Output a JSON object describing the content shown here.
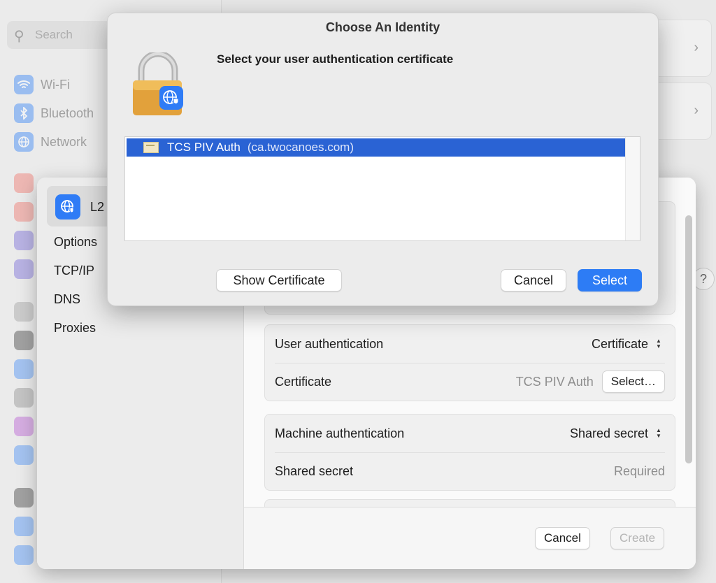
{
  "background": {
    "search_placeholder": "Search",
    "sidebar_items": [
      {
        "label": "Wi-Fi",
        "icon": "wifi-icon",
        "color": "#3a86f7"
      },
      {
        "label": "Bluetooth",
        "icon": "bluetooth-icon",
        "color": "#3a86f7"
      },
      {
        "label": "Network",
        "icon": "globe-icon",
        "color": "#3a86f7"
      }
    ],
    "help_label": "?"
  },
  "sheet": {
    "vpn_name": "L2",
    "nav": [
      "Options",
      "TCP/IP",
      "DNS",
      "Proxies"
    ],
    "user_auth": {
      "label": "User authentication",
      "value": "Certificate"
    },
    "certificate": {
      "label": "Certificate",
      "value": "TCS PIV Auth",
      "button": "Select…"
    },
    "machine_auth": {
      "label": "Machine authentication",
      "value": "Shared secret"
    },
    "shared_secret": {
      "label": "Shared secret",
      "placeholder": "Required"
    },
    "cancel": "Cancel",
    "create": "Create"
  },
  "dialog": {
    "title": "Choose An Identity",
    "prompt": "Select your user authentication certificate",
    "certs": [
      {
        "name": "TCS PIV Auth",
        "issuer": "(ca.twocanoes.com)"
      }
    ],
    "show_certificate": "Show Certificate",
    "cancel": "Cancel",
    "select": "Select"
  },
  "colors": {
    "accent": "#2d7cf5",
    "selection": "#2a63d4"
  }
}
